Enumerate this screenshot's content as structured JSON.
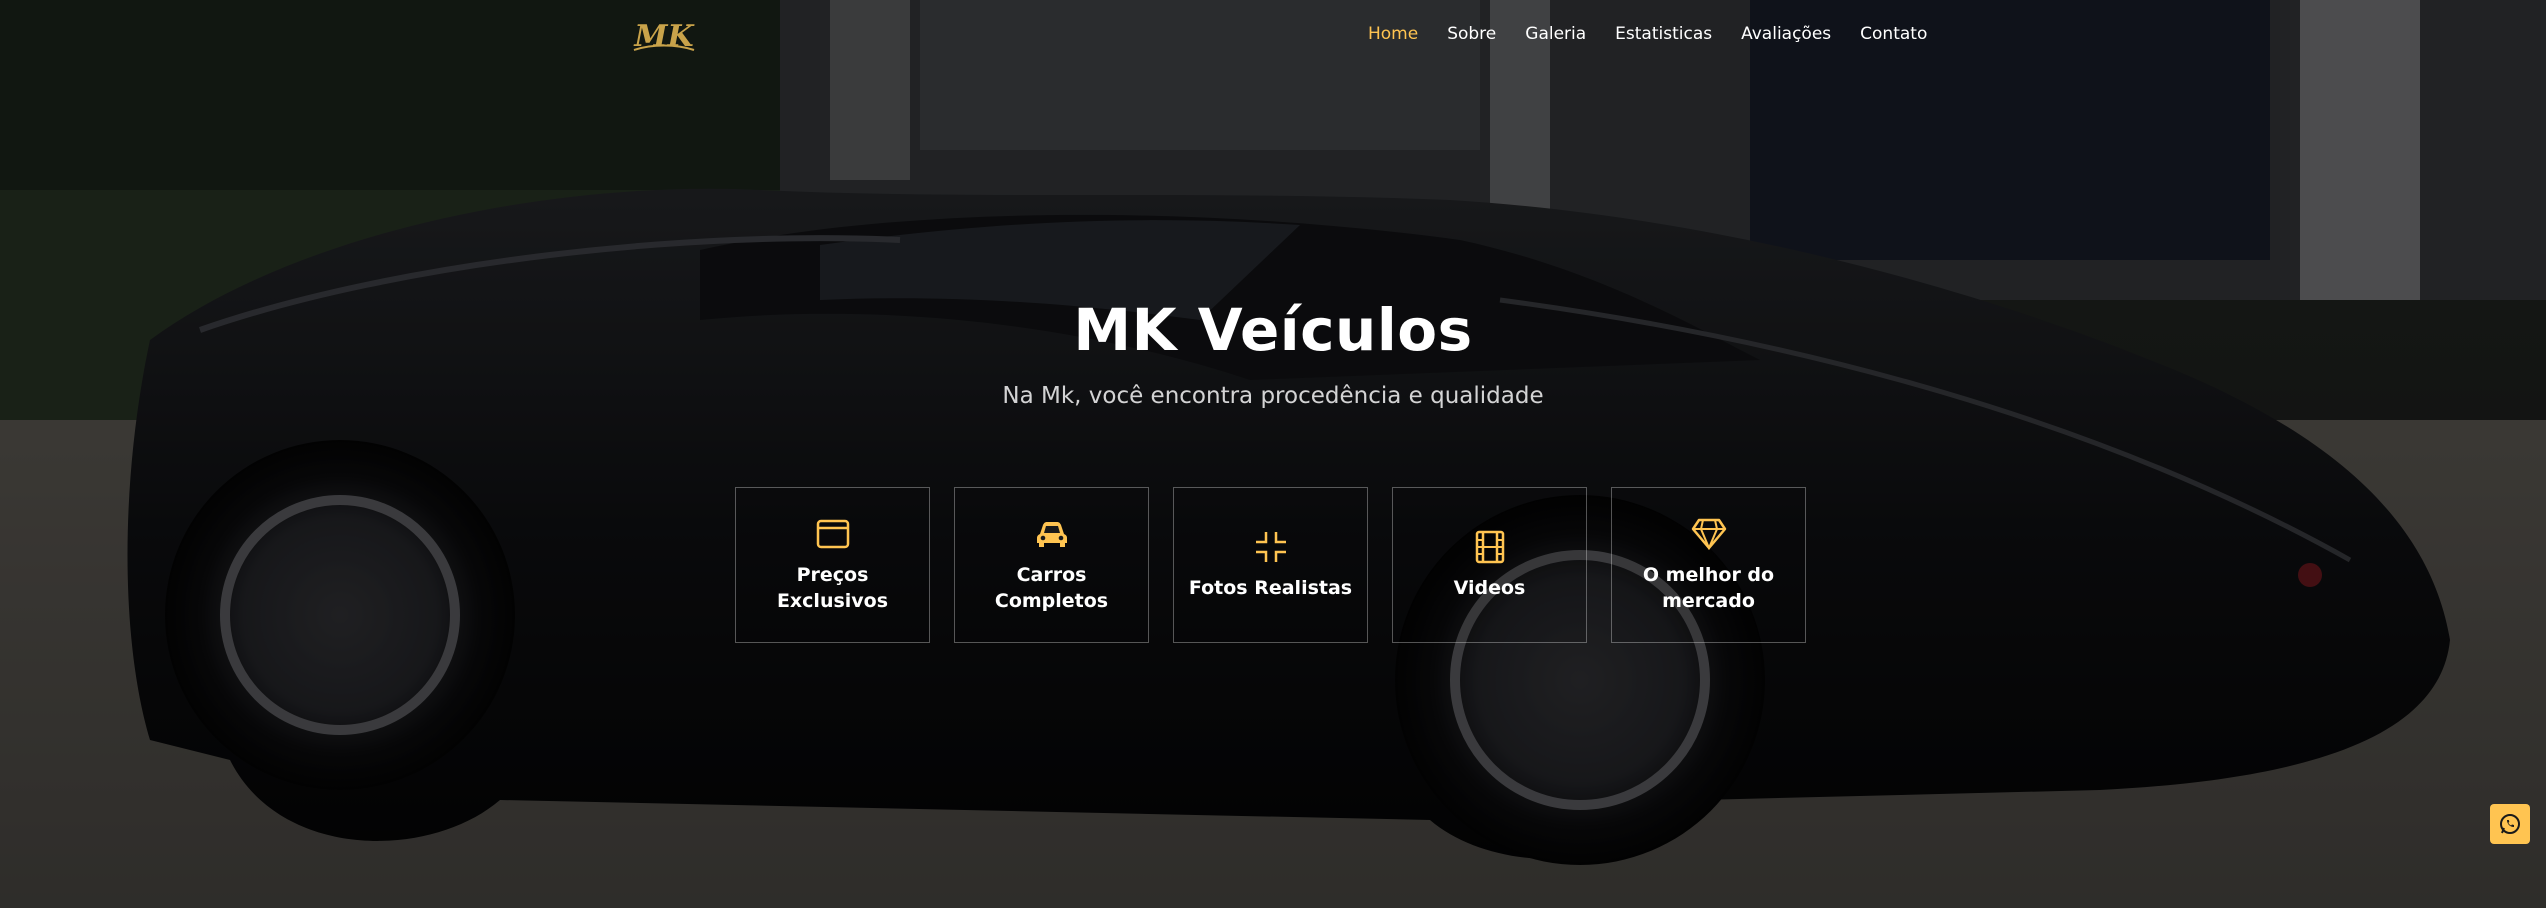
{
  "header": {
    "logo_text": "MK",
    "nav": [
      {
        "label": "Home",
        "active": true
      },
      {
        "label": "Sobre"
      },
      {
        "label": "Galeria"
      },
      {
        "label": "Estatisticas"
      },
      {
        "label": "Avaliações"
      },
      {
        "label": "Contato"
      }
    ]
  },
  "hero": {
    "title": "MK Veículos",
    "subtitle": "Na Mk, você encontra procedência e qualidade"
  },
  "features": [
    {
      "icon": "browser-window-icon",
      "label": "Preços Exclusivos"
    },
    {
      "icon": "car-icon",
      "label": "Carros Completos"
    },
    {
      "icon": "compress-icon",
      "label": "Fotos Realistas"
    },
    {
      "icon": "film-icon",
      "label": "Videos"
    },
    {
      "icon": "diamond-icon",
      "label": "O melhor do mercado"
    }
  ],
  "colors": {
    "accent": "#ffc451",
    "text": "#ffffff"
  },
  "floating": {
    "whatsapp_icon": "whatsapp-icon"
  }
}
